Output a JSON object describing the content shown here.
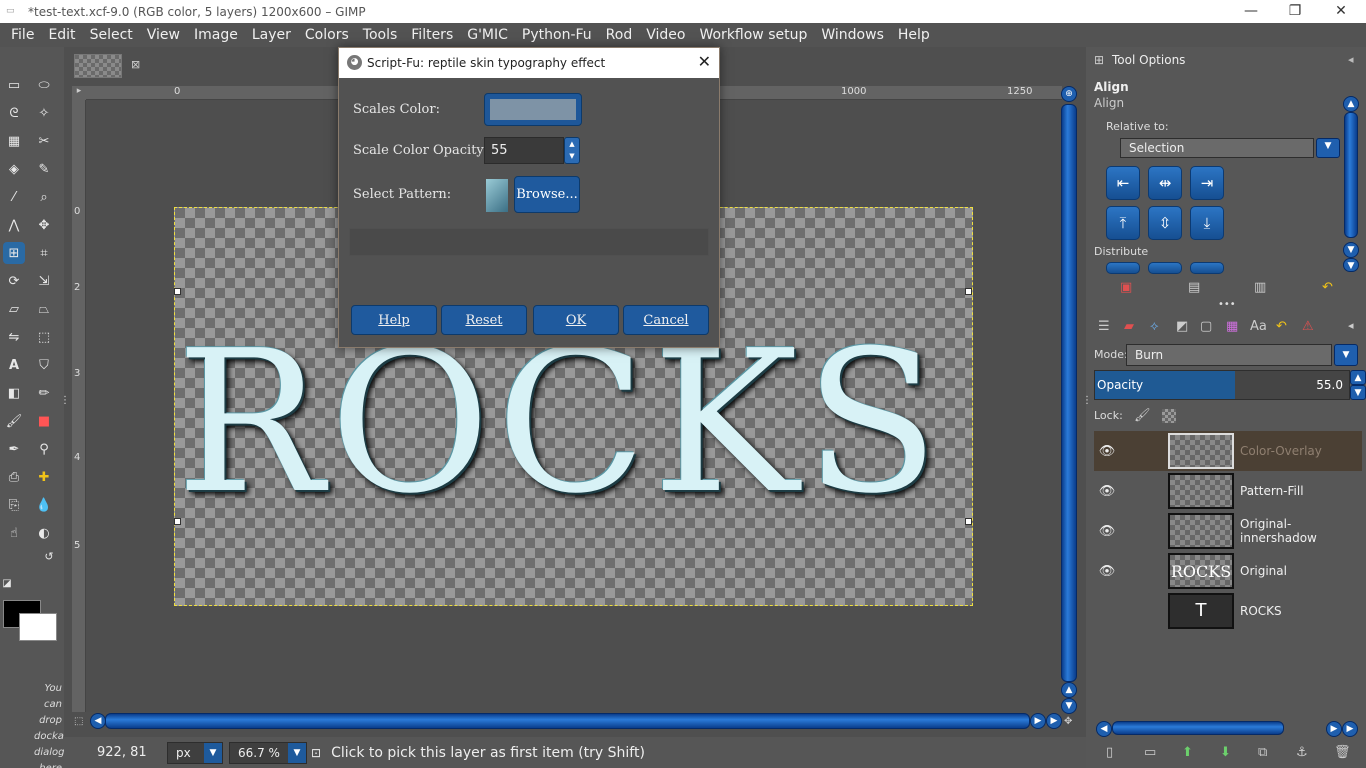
{
  "window": {
    "title": "*test-text.xcf-9.0 (RGB color, 5 layers) 1200x600 – GIMP",
    "controls": {
      "minimize": "—",
      "restore": "❐",
      "close": "✕"
    }
  },
  "menubar": [
    "File",
    "Edit",
    "Select",
    "View",
    "Image",
    "Layer",
    "Colors",
    "Tools",
    "Filters",
    "G'MIC",
    "Python-Fu",
    "Rod",
    "Video",
    "Workflow setup",
    "Windows",
    "Help"
  ],
  "toolbox": {
    "drop_hint": "You can drop dockable dialogs here",
    "fg_color": "#000000",
    "bg_color": "#ffffff"
  },
  "rulers": {
    "top": [
      "0",
      "1000",
      "1250"
    ],
    "left": [
      "0",
      "2",
      "3",
      "4",
      "5"
    ]
  },
  "canvas": {
    "text": "ROCKS"
  },
  "statusbar": {
    "coords": "922, 81",
    "unit": "px",
    "zoom": "66.7 %",
    "message": "Click to pick this layer as first item (try Shift)"
  },
  "tool_options": {
    "title": "Tool Options",
    "tool_name": "Align",
    "tool_sub": "Align",
    "relative_label": "Relative to:",
    "relative_value": "Selection",
    "distribute_label": "Distribute"
  },
  "layers_panel": {
    "mode_label": "Mode:",
    "mode_value": "Burn",
    "opacity_label": "Opacity",
    "opacity_value": "55.0",
    "opacity_fraction": 0.55,
    "lock_label": "Lock:",
    "layers": [
      {
        "name": "Color-Overlay",
        "visible": true,
        "selected": true
      },
      {
        "name": "Pattern-Fill",
        "visible": true,
        "selected": false
      },
      {
        "name": "Original-innershadow",
        "visible": true,
        "selected": false
      },
      {
        "name": "Original",
        "visible": true,
        "selected": false,
        "thumb_text": "ROCKS"
      },
      {
        "name": "ROCKS",
        "visible": false,
        "selected": false,
        "thumb_text": "T"
      }
    ]
  },
  "dialog": {
    "title": "Script-Fu: reptile skin typography effect",
    "scales_color_label": "Scales Color:",
    "scales_color_value": "#7e93a6",
    "opacity_label": "Scale Color Opacity:",
    "opacity_value": "55",
    "pattern_label": "Select Pattern:",
    "browse_label": "Browse...",
    "buttons": {
      "help": "Help",
      "reset": "Reset",
      "ok": "OK",
      "cancel": "Cancel"
    }
  }
}
